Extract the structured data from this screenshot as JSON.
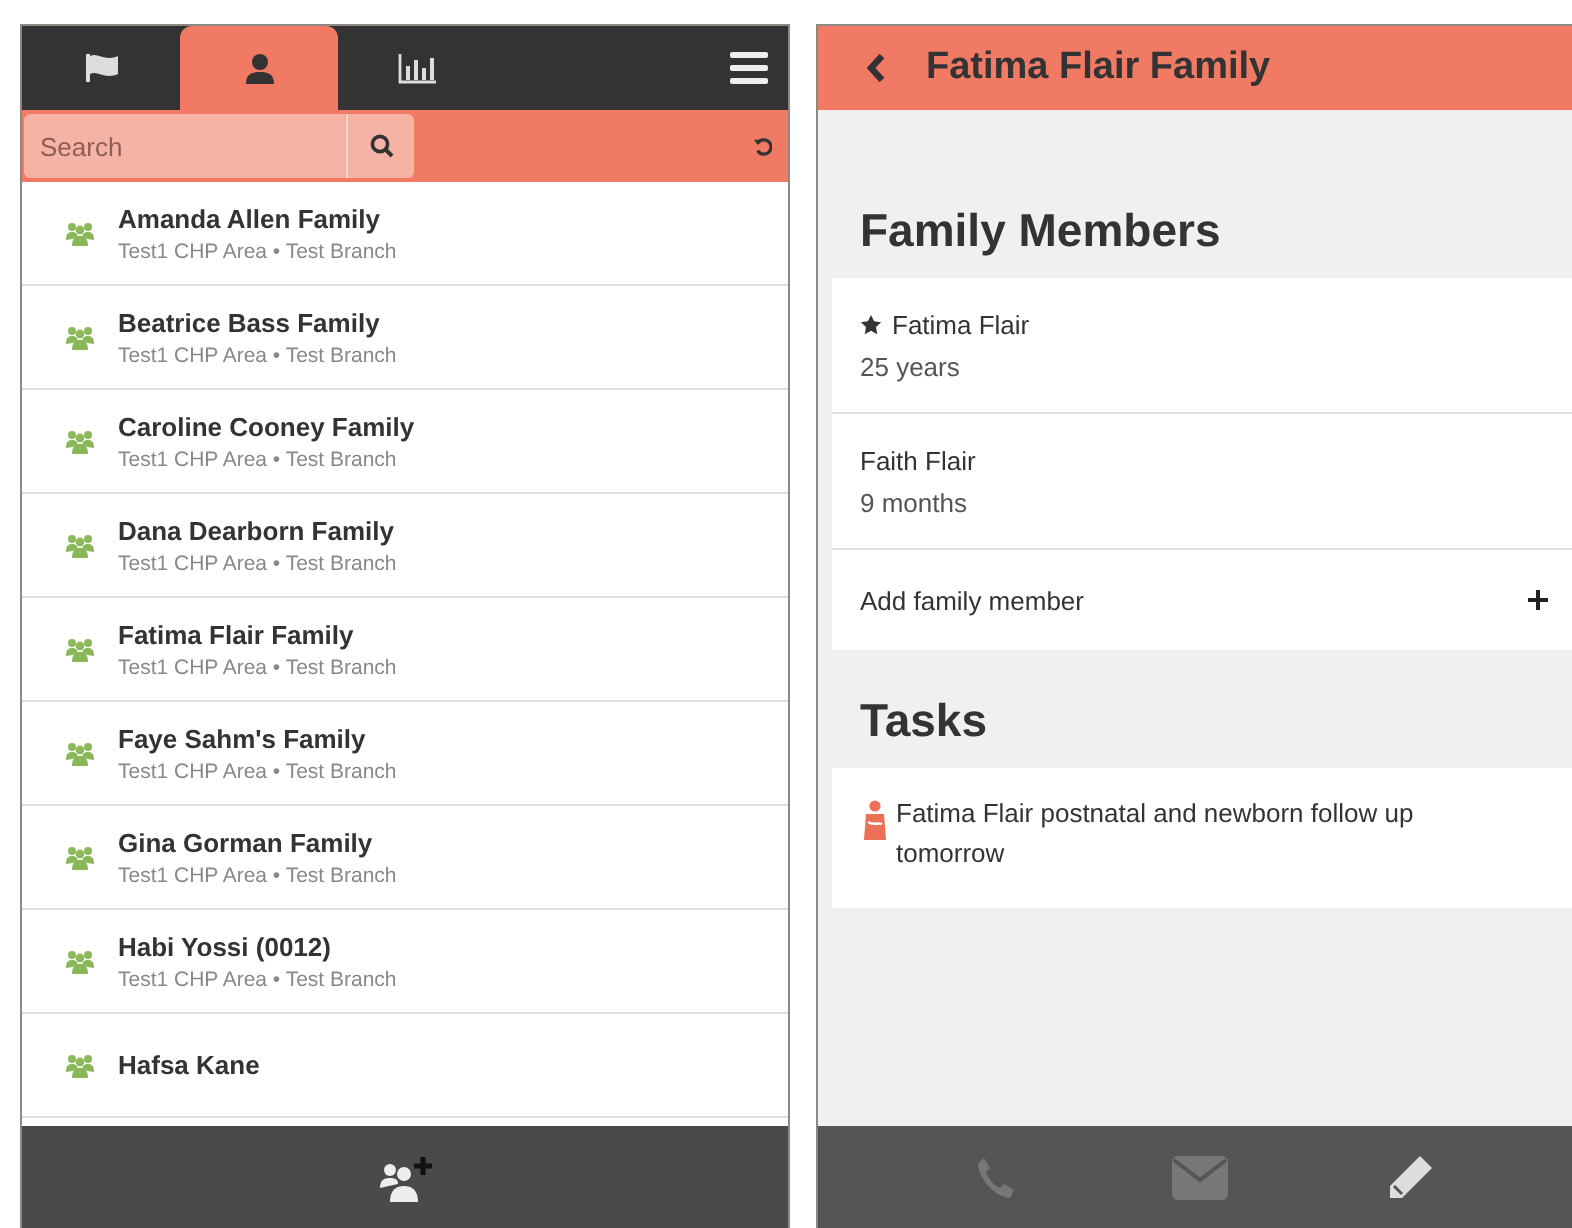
{
  "family_list_screen": {
    "tabs": [
      {
        "kind": "flag",
        "selected": false
      },
      {
        "kind": "person",
        "selected": true
      },
      {
        "kind": "chart",
        "selected": false
      }
    ],
    "search": {
      "placeholder": "Search"
    },
    "families": [
      {
        "name": "Amanda Allen Family",
        "location": "Test1 CHP Area • Test Branch"
      },
      {
        "name": "Beatrice Bass Family",
        "location": "Test1 CHP Area • Test Branch"
      },
      {
        "name": "Caroline Cooney Family",
        "location": "Test1 CHP Area • Test Branch"
      },
      {
        "name": "Dana Dearborn Family",
        "location": "Test1 CHP Area • Test Branch"
      },
      {
        "name": "Fatima Flair Family",
        "location": "Test1 CHP Area • Test Branch"
      },
      {
        "name": "Faye Sahm's Family",
        "location": "Test1 CHP Area • Test Branch"
      },
      {
        "name": "Gina Gorman Family",
        "location": "Test1 CHP Area • Test Branch"
      },
      {
        "name": "Habi Yossi (0012)",
        "location": "Test1 CHP Area • Test Branch"
      },
      {
        "name": "Hafsa Kane"
      }
    ]
  },
  "family_detail_screen": {
    "title": "Fatima Flair Family",
    "members_heading": "Family Members",
    "members": [
      {
        "name": "Fatima Flair",
        "age": "25 years",
        "starred": true
      },
      {
        "name": "Faith Flair",
        "age": "9 months",
        "starred": false
      }
    ],
    "add_member": "Add family member",
    "tasks_heading": "Tasks",
    "tasks": [
      {
        "text": "Fatima Flair postnatal and newborn follow up tomorrow"
      }
    ]
  }
}
